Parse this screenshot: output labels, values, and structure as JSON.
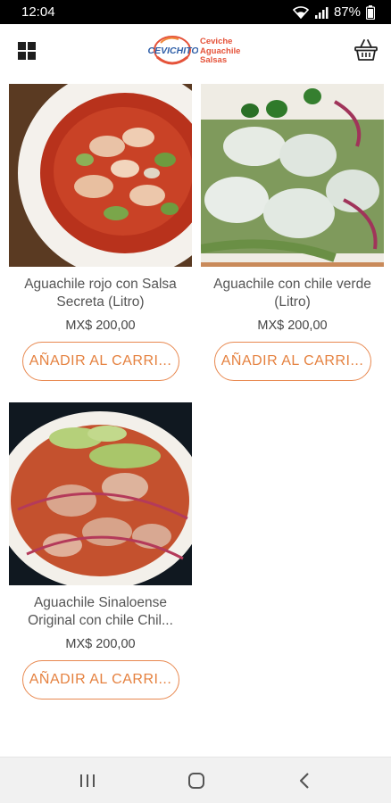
{
  "status_bar": {
    "time": "12:04",
    "battery": "87%",
    "icons": [
      "wifi-icon",
      "signal-icon",
      "battery-icon"
    ]
  },
  "app_bar": {
    "menu_icon": "grid-menu-icon",
    "logo": {
      "brand": "CEVICHITO",
      "lines": [
        "Ceviche",
        "Aguachile",
        "Salsas"
      ]
    },
    "cart_icon": "shopping-basket-icon"
  },
  "products": [
    {
      "name": "Aguachile rojo con Salsa Secreta (Litro)",
      "price": "MX$ 200,00",
      "add_label": "AÑADIR AL CARRI..."
    },
    {
      "name": "Aguachile con chile verde (Litro)",
      "price": "MX$ 200,00",
      "add_label": "AÑADIR AL CARRI..."
    },
    {
      "name": "Aguachile Sinaloense Original con chile Chil...",
      "price": "MX$ 200,00",
      "add_label": "AÑADIR AL CARRI..."
    }
  ],
  "nav_bar": {
    "icons": [
      "recent-apps-icon",
      "home-icon",
      "back-icon"
    ]
  },
  "colors": {
    "accent": "#e5813f",
    "brand_red": "#e5533a",
    "brand_blue": "#2f5fa8"
  }
}
